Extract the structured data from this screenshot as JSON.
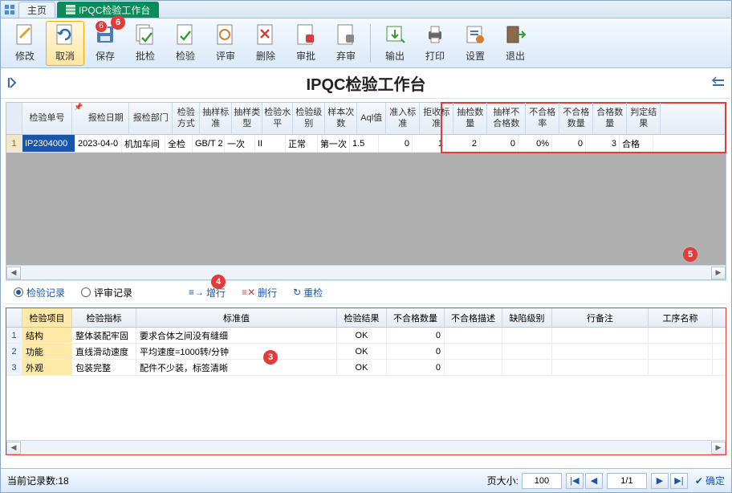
{
  "tabs": {
    "home": "主页",
    "active": "IPQC检验工作台"
  },
  "toolbar": {
    "modify": "修改",
    "cancel": "取消",
    "save": "保存",
    "batch": "批检",
    "inspect": "检验",
    "review": "评审",
    "delete": "删除",
    "approve": "审批",
    "discard": "弃审",
    "export": "输出",
    "print": "打印",
    "settings": "设置",
    "exit": "退出",
    "save_badge": "6"
  },
  "title": "IPQC检验工作台",
  "grid": {
    "headers": [
      "检验单号",
      "报检日期",
      "报检部门",
      "检验方式",
      "抽样标准",
      "抽样类型",
      "检验水平",
      "检验级别",
      "样本次数",
      "Aql值",
      "准入标准",
      "拒收标准",
      "抽检数量",
      "抽样不合格数",
      "不合格率",
      "不合格数量",
      "合格数量",
      "判定结果"
    ],
    "row": {
      "num": "1",
      "cells": [
        "IP2304000",
        "2023-04-0",
        "机加车间",
        "全检",
        "GB/T 2",
        "一次",
        "II",
        "正常",
        "第一次",
        "1.5",
        "0",
        "1",
        "2",
        "0",
        "0%",
        "0",
        "3",
        "合格"
      ]
    }
  },
  "subbar": {
    "radio_inspect": "检验记录",
    "radio_review": "评审记录",
    "add": "增行",
    "del": "删行",
    "recheck": "重检"
  },
  "detail": {
    "headers": [
      "检验项目",
      "检验指标",
      "标准值",
      "检验结果",
      "不合格数量",
      "不合格描述",
      "缺陷级别",
      "行备注",
      "工序名称"
    ],
    "rows": [
      {
        "num": "1",
        "item": "结构",
        "metric": "整体装配牢固",
        "std": "要求合体之间没有缝细",
        "res": "OK",
        "nq": "0"
      },
      {
        "num": "2",
        "item": "功能",
        "metric": "直线滑动速度",
        "std": "平均速度=1000转/分钟",
        "res": "OK",
        "nq": "0"
      },
      {
        "num": "3",
        "item": "外观",
        "metric": "包装完整",
        "std": "配件不少装，标签清晰",
        "res": "OK",
        "nq": "0"
      }
    ]
  },
  "status": {
    "count_label": "当前记录数:",
    "count": "18",
    "pagesize_label": "页大小:",
    "pagesize": "100",
    "page": "1/1",
    "ok": "确定"
  },
  "annotations": {
    "a3": "3",
    "a4": "4",
    "a5": "5",
    "a6": "6"
  }
}
